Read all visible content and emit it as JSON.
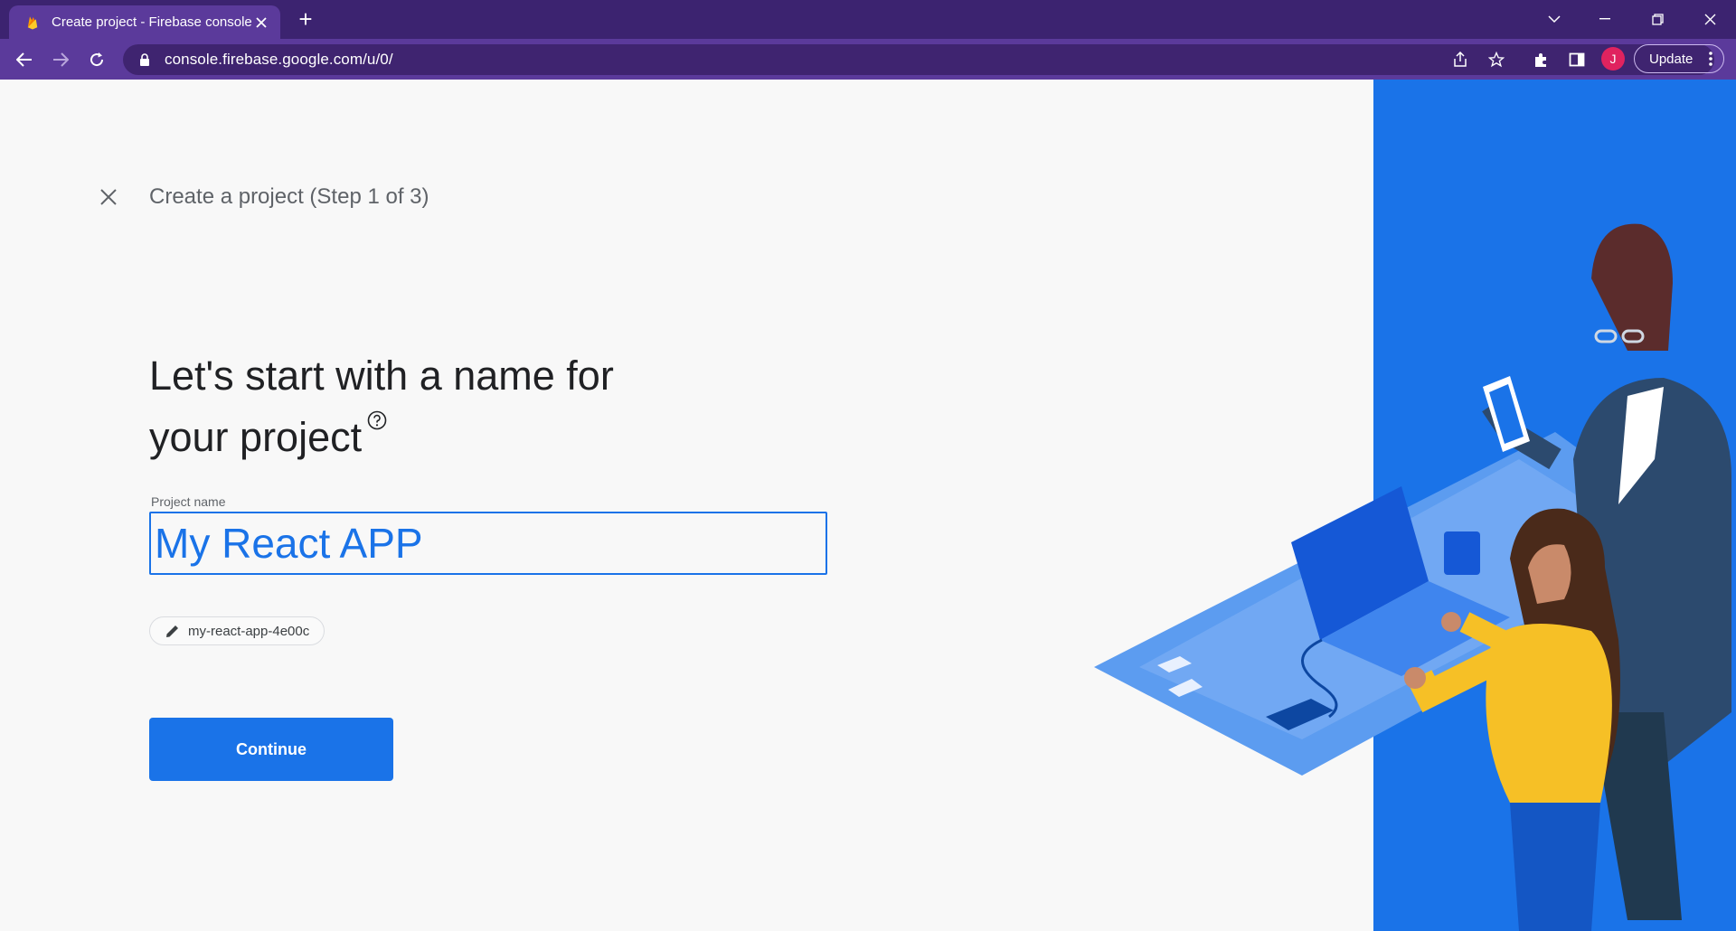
{
  "browser": {
    "tab_title": "Create project - Firebase console",
    "url": "console.firebase.google.com/u/0/",
    "profile_initial": "J",
    "update_label": "Update"
  },
  "page": {
    "step_title": "Create a project (Step 1 of 3)",
    "headline_line1": "Let's start with a name for",
    "headline_line2": "your project",
    "field_label": "Project name",
    "project_name_value": "My React APP",
    "project_id": "my-react-app-4e00c",
    "continue_label": "Continue"
  },
  "colors": {
    "brand_blue": "#1a73e8",
    "chrome_purple": "#5b3a9b"
  }
}
